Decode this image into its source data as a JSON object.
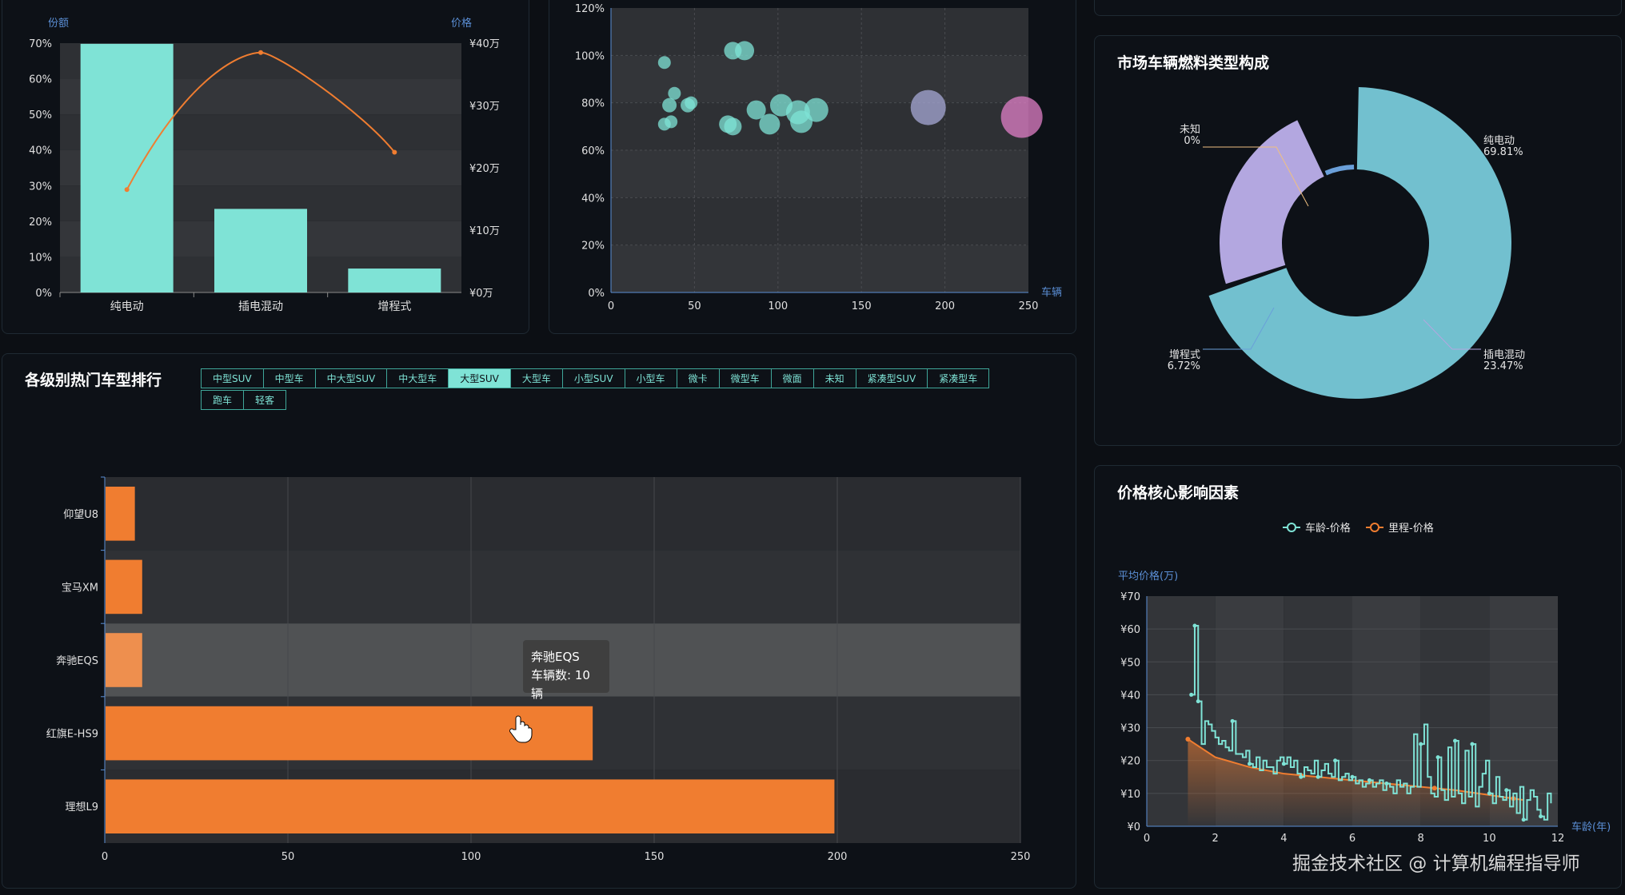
{
  "panels": {
    "rank_title": "各级别热门车型排行",
    "fuel_title": "市场车辆燃料类型构成",
    "price_title": "价格核心影响因素"
  },
  "tabs": [
    {
      "label": "中型SUV",
      "active": false
    },
    {
      "label": "中型车",
      "active": false
    },
    {
      "label": "中大型SUV",
      "active": false
    },
    {
      "label": "中大型车",
      "active": false
    },
    {
      "label": "大型SUV",
      "active": true
    },
    {
      "label": "大型车",
      "active": false
    },
    {
      "label": "小型SUV",
      "active": false
    },
    {
      "label": "小型车",
      "active": false
    },
    {
      "label": "微卡",
      "active": false
    },
    {
      "label": "微型车",
      "active": false
    },
    {
      "label": "微面",
      "active": false
    },
    {
      "label": "未知",
      "active": false
    },
    {
      "label": "紧凑型SUV",
      "active": false
    },
    {
      "label": "紧凑型车",
      "active": false
    },
    {
      "label": "跑车",
      "active": false
    },
    {
      "label": "轻客",
      "active": false
    }
  ],
  "tooltip": {
    "name": "奔驰EQS",
    "detail": "车辆数: 10辆"
  },
  "watermark": "掘金技术社区 @ 计算机编程指导师",
  "colors": {
    "teal": "#7fe3d6",
    "orange": "#f07d30",
    "bg": "#0d1117",
    "plot_bg": "#2e3034"
  },
  "chart_data": [
    {
      "type": "bar",
      "categories": [
        "纯电动",
        "插电混动",
        "增程式"
      ],
      "series": [
        {
          "name": "份额",
          "type": "bar",
          "values": [
            69.81,
            23.47,
            6.72
          ]
        },
        {
          "name": "价格",
          "type": "line",
          "axis": "right",
          "values": [
            16.5,
            38.5,
            22.5
          ]
        }
      ],
      "ylabel": "份额",
      "ylabel_right": "价格",
      "ylim": [
        0,
        70
      ],
      "ylim_right": [
        0,
        40
      ],
      "yticks": [
        "0%",
        "10%",
        "20%",
        "30%",
        "40%",
        "50%",
        "60%",
        "70%"
      ],
      "yticks_right": [
        "¥0万",
        "¥10万",
        "¥20万",
        "¥30万",
        "¥40万"
      ]
    },
    {
      "type": "scatter",
      "xlabel": "车辆",
      "xlim": [
        0,
        250
      ],
      "ylim": [
        0,
        120
      ],
      "xticks": [
        "0",
        "50",
        "100",
        "150",
        "200",
        "250"
      ],
      "yticks": [
        "0%",
        "20%",
        "40%",
        "60%",
        "80%",
        "100%",
        "120%"
      ],
      "points": [
        {
          "x": 32,
          "y": 97,
          "size": 8,
          "color": "#7fe3d6"
        },
        {
          "x": 73,
          "y": 102,
          "size": 11,
          "color": "#7fe3d6"
        },
        {
          "x": 80,
          "y": 102,
          "size": 12,
          "color": "#7fe3d6"
        },
        {
          "x": 38,
          "y": 84,
          "size": 8,
          "color": "#7fe3d6"
        },
        {
          "x": 35,
          "y": 79,
          "size": 9,
          "color": "#7fe3d6"
        },
        {
          "x": 36,
          "y": 72,
          "size": 8,
          "color": "#7fe3d6"
        },
        {
          "x": 32,
          "y": 71,
          "size": 8,
          "color": "#7fe3d6"
        },
        {
          "x": 46,
          "y": 79,
          "size": 9,
          "color": "#7fe3d6"
        },
        {
          "x": 48,
          "y": 80,
          "size": 8,
          "color": "#7fe3d6"
        },
        {
          "x": 70,
          "y": 71,
          "size": 11,
          "color": "#7fe3d6"
        },
        {
          "x": 73,
          "y": 70,
          "size": 11,
          "color": "#7fe3d6"
        },
        {
          "x": 87,
          "y": 77,
          "size": 12,
          "color": "#7fe3d6"
        },
        {
          "x": 95,
          "y": 71,
          "size": 13,
          "color": "#7fe3d6"
        },
        {
          "x": 102,
          "y": 79,
          "size": 14,
          "color": "#7fe3d6"
        },
        {
          "x": 112,
          "y": 76,
          "size": 15,
          "color": "#7fe3d6"
        },
        {
          "x": 114,
          "y": 72,
          "size": 14,
          "color": "#7fe3d6"
        },
        {
          "x": 123,
          "y": 77,
          "size": 15,
          "color": "#7fe3d6"
        },
        {
          "x": 190,
          "y": 78,
          "size": 22,
          "color": "#a7a8d6"
        },
        {
          "x": 246,
          "y": 74,
          "size": 26,
          "color": "#e07fc7"
        }
      ]
    },
    {
      "type": "pie",
      "slices": [
        {
          "name": "纯电动",
          "value": 69.81,
          "label": "69.81%",
          "color": "#72c0cf"
        },
        {
          "name": "插电混动",
          "value": 23.47,
          "label": "23.47%",
          "color": "#b3a7e0"
        },
        {
          "name": "增程式",
          "value": 6.72,
          "label": "6.72%",
          "color": "#6a9fd9"
        },
        {
          "name": "未知",
          "value": 0,
          "label": "0%",
          "color": "#f0c080"
        }
      ]
    },
    {
      "type": "bar",
      "orientation": "horizontal",
      "categories": [
        "仰望U8",
        "宝马XM",
        "奔驰EQS",
        "红旗E-HS9",
        "理想L9"
      ],
      "values": [
        8,
        10,
        10,
        133,
        199
      ],
      "xlim": [
        0,
        250
      ],
      "xticks": [
        "0",
        "50",
        "100",
        "150",
        "200",
        "250"
      ],
      "highlight": "奔驰EQS"
    },
    {
      "type": "line",
      "ylabel": "平均价格(万)",
      "xlabel": "车龄(年)",
      "xlim": [
        0,
        12
      ],
      "ylim": [
        0,
        70
      ],
      "xticks": [
        "0",
        "2",
        "4",
        "6",
        "8",
        "10",
        "12"
      ],
      "yticks": [
        "¥0",
        "¥10",
        "¥20",
        "¥30",
        "¥40",
        "¥50",
        "¥60",
        "¥70"
      ],
      "series": [
        {
          "name": "车龄-价格",
          "color": "#7fe3d6",
          "x": [
            1.3,
            1.4,
            1.5,
            1.6,
            1.7,
            1.8,
            1.9,
            2.0,
            2.1,
            2.2,
            2.3,
            2.4,
            2.5,
            2.6,
            2.7,
            2.8,
            2.9,
            3.0,
            3.1,
            3.2,
            3.3,
            3.4,
            3.5,
            3.6,
            3.7,
            3.8,
            3.9,
            4.0,
            4.1,
            4.2,
            4.3,
            4.4,
            4.5,
            4.6,
            4.7,
            4.8,
            4.9,
            5.0,
            5.1,
            5.2,
            5.3,
            5.4,
            5.5,
            5.6,
            5.7,
            5.8,
            5.9,
            6.0,
            6.1,
            6.2,
            6.3,
            6.4,
            6.5,
            6.6,
            6.7,
            6.8,
            6.9,
            7.0,
            7.1,
            7.2,
            7.3,
            7.4,
            7.5,
            7.6,
            7.7,
            7.8,
            7.9,
            8.0,
            8.1,
            8.2,
            8.3,
            8.4,
            8.5,
            8.6,
            8.7,
            8.8,
            8.9,
            9.0,
            9.1,
            9.2,
            9.3,
            9.4,
            9.5,
            9.6,
            9.7,
            9.8,
            9.9,
            10.0,
            10.1,
            10.2,
            10.3,
            10.4,
            10.5,
            10.6,
            10.7,
            10.8,
            10.9,
            11.0,
            11.1,
            11.2,
            11.3,
            11.4,
            11.5,
            11.6,
            11.7,
            11.8
          ],
          "y": [
            40,
            61,
            38,
            25,
            32,
            31,
            29,
            27,
            25,
            26,
            24,
            23,
            32,
            22,
            22,
            21,
            23,
            19,
            18,
            21,
            17,
            20,
            18,
            18,
            16,
            20,
            21,
            19,
            21,
            18,
            20,
            16,
            15,
            18,
            17,
            16,
            20,
            15,
            17,
            19,
            16,
            15,
            20,
            14,
            15,
            16,
            14,
            15,
            13,
            14,
            12,
            13,
            14,
            12,
            13,
            14,
            11,
            13,
            12,
            10,
            14,
            12,
            13,
            10,
            12,
            28,
            12,
            25,
            31,
            15,
            10,
            9,
            21,
            11,
            8,
            24,
            9,
            26,
            10,
            7,
            23,
            9,
            25,
            6,
            12,
            16,
            20,
            10,
            7,
            15,
            9,
            8,
            11,
            6,
            10,
            4,
            12,
            2,
            8,
            11,
            9,
            5,
            3,
            2,
            10,
            7
          ],
          "markers": [
            1.3,
            1.4,
            1.5,
            2.5,
            3.0,
            4.0,
            4.5,
            5.0,
            5.5,
            6.0,
            6.5,
            7.0,
            8.0,
            8.5,
            9.0,
            9.5,
            10.0,
            10.5,
            11.0,
            11.5
          ]
        },
        {
          "name": "里程-价格",
          "color": "#f07d30",
          "x": [
            1.2,
            2,
            3,
            4,
            5,
            6,
            7,
            8,
            9,
            10,
            11
          ],
          "y": [
            26.5,
            21,
            18,
            16,
            15,
            14,
            13,
            12,
            11,
            9.5,
            8
          ],
          "markers": [
            1.2,
            4.5,
            6.5,
            8.4,
            10.7
          ]
        }
      ]
    }
  ]
}
